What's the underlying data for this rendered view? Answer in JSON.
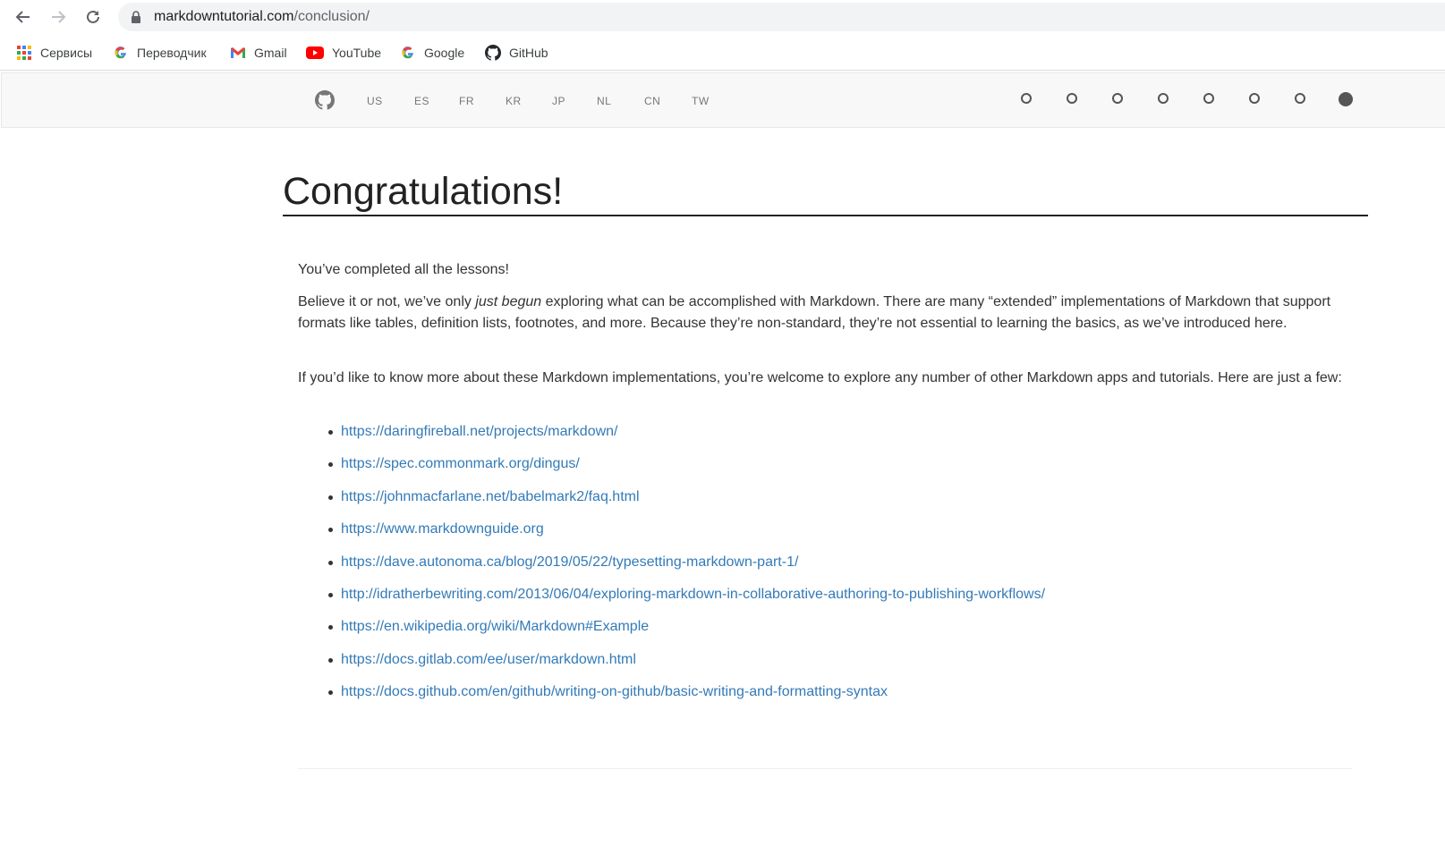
{
  "browser": {
    "url_host": "markdowntutorial.com",
    "url_path": "/conclusion/",
    "bookmarks": [
      {
        "label": "Сервисы",
        "icon": "apps-grid-icon"
      },
      {
        "label": "Переводчик",
        "icon": "google-g-icon"
      },
      {
        "label": "Gmail",
        "icon": "gmail-icon"
      },
      {
        "label": "YouTube",
        "icon": "youtube-icon"
      },
      {
        "label": "Google",
        "icon": "google-g-icon"
      },
      {
        "label": "GitHub",
        "icon": "github-icon"
      }
    ]
  },
  "site_nav": {
    "languages": [
      "US",
      "ES",
      "FR",
      "KR",
      "JP",
      "NL",
      "CN",
      "TW"
    ],
    "lesson_dots_count": 8,
    "active_dot": 8
  },
  "content": {
    "title": "Congratulations!",
    "p1": "You’ve completed all the lessons!",
    "p2_before": "Believe it or not, we’ve only ",
    "p2_em": "just begun",
    "p2_after": " exploring what can be accomplished with Markdown. There are many “extended” implementations of Markdown that support formats like tables, definition lists, footnotes, and more. Because they’re non-standard, they’re not essential to learning the basics, as we’ve introduced here.",
    "p3": "If you’d like to know more about these Markdown implementations, you’re welcome to explore any number of other Markdown apps and tutorials. Here are just a few:",
    "links": [
      "https://daringfireball.net/projects/markdown/",
      "https://spec.commonmark.org/dingus/",
      "https://johnmacfarlane.net/babelmark2/faq.html",
      "https://www.markdownguide.org",
      "https://dave.autonoma.ca/blog/2019/05/22/typesetting-markdown-part-1/",
      "http://idratherbewriting.com/2013/06/04/exploring-markdown-in-collaborative-authoring-to-publishing-workflows/",
      "https://en.wikipedia.org/wiki/Markdown#Example",
      "https://docs.gitlab.com/ee/user/markdown.html",
      "https://docs.github.com/en/github/writing-on-github/basic-writing-and-formatting-syntax"
    ]
  },
  "colors": {
    "link": "#337ab7",
    "nav_bg": "#f8f8f8",
    "text": "#333333"
  }
}
